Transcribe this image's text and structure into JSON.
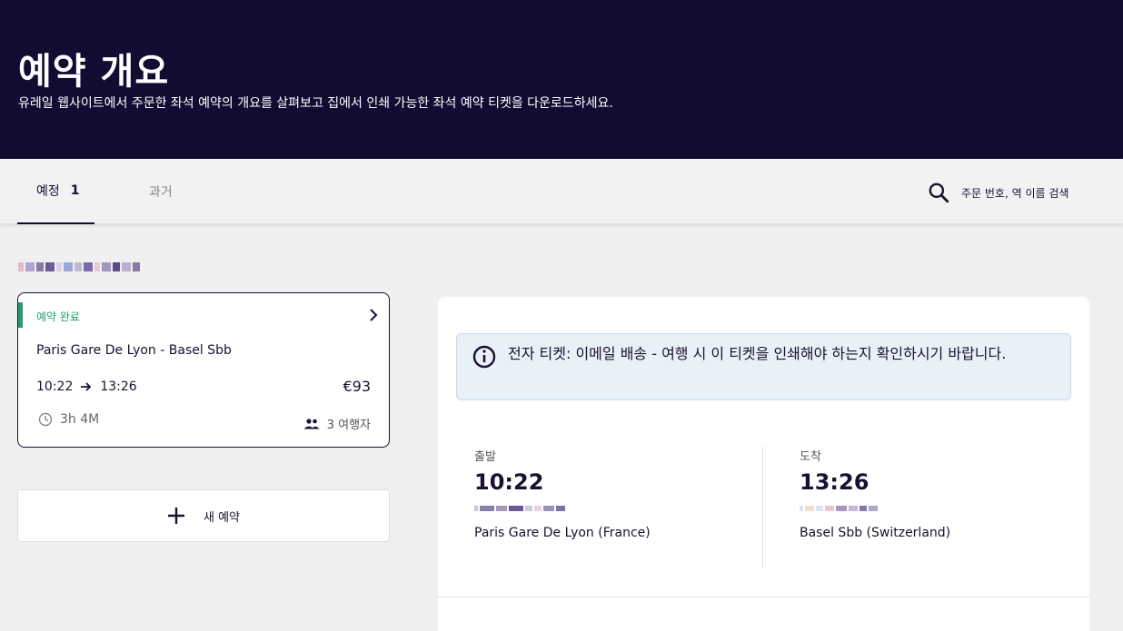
{
  "hero": {
    "title": "예약 개요",
    "subtitle": "유레일 웹사이트에서 주문한 좌석 예약의 개요를 살펴보고 집에서 인쇄 가능한 좌석 예약 티켓을 다운로드하세요."
  },
  "tabs": {
    "upcoming_label": "예정",
    "upcoming_count": "1",
    "past_label": "과거"
  },
  "search": {
    "label": "주문 번호, 역 이름 검색"
  },
  "booking": {
    "status": "예약 완료",
    "route": "Paris Gare De Lyon  -  Basel Sbb",
    "departure_time": "10:22",
    "arrival_time": "13:26",
    "price": "€93",
    "duration": "3h 4M",
    "passengers": "3 여행자"
  },
  "new_booking": {
    "label": "새 예약"
  },
  "detail": {
    "info_text": "전자 티켓: 이메일 배송 - 여행 시 이 티켓을 인쇄해야 하는지 확인하시기 바랍니다.",
    "departure": {
      "label": "출발",
      "time": "10:22",
      "station": "Paris Gare De Lyon (France)"
    },
    "arrival": {
      "label": "도착",
      "time": "13:26",
      "station": "Basel Sbb (Switzerland)"
    }
  },
  "colors": {
    "hero_bg": "#140b33",
    "accent_green": "#22a06b",
    "info_bg": "#e8f0f8"
  }
}
